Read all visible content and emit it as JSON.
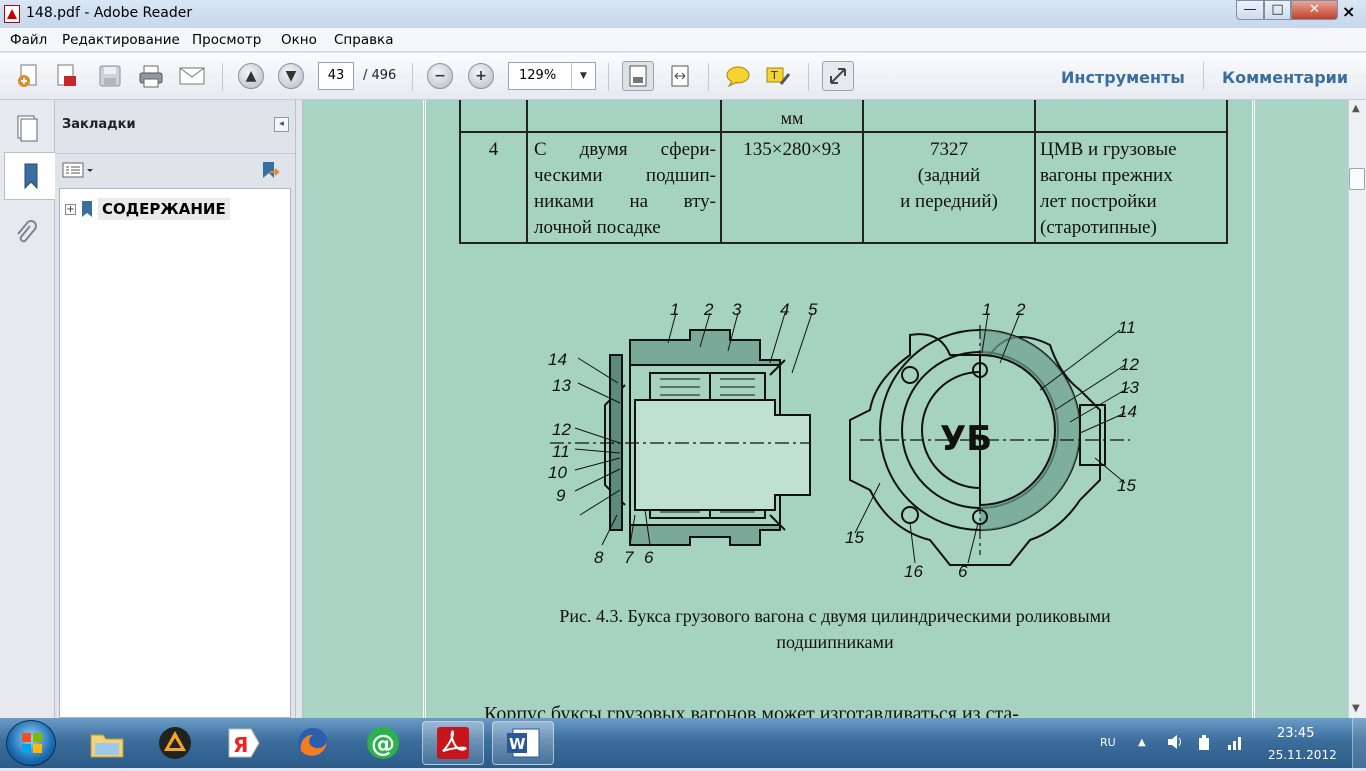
{
  "window": {
    "title": "148.pdf - Adobe Reader",
    "minimize": "—",
    "maximize": "□",
    "close": "✕"
  },
  "menu": {
    "items": [
      "Файл",
      "Редактирование",
      "Просмотр",
      "Окно",
      "Справка"
    ],
    "close_doc": "×"
  },
  "toolbar": {
    "page_current": "43",
    "page_total": "/ 496",
    "zoom": "129%",
    "tools_label": "Инструменты",
    "comments_label": "Комментарии"
  },
  "sidebar": {
    "panel_title": "Закладки",
    "bookmark": "СОДЕРЖАНИЕ"
  },
  "document": {
    "table_header": [
      "мм"
    ],
    "row": {
      "num": "4",
      "desc": [
        "С двумя сфери-",
        "ческими подшип-",
        "никами на вту-",
        "лочной посадке"
      ],
      "size": "135×280×93",
      "code": [
        "7327",
        "(задний",
        "и передний)"
      ],
      "usage": [
        "ЦМВ и грузовые",
        "вагоны прежних",
        "лет постройки",
        "(старотипные)"
      ]
    },
    "figure_labels_left": [
      "1",
      "2",
      "3",
      "4",
      "5",
      "14",
      "13",
      "12",
      "11",
      "10",
      "9",
      "8",
      "7",
      "6"
    ],
    "figure_labels_right": [
      "1",
      "2",
      "11",
      "12",
      "13",
      "14",
      "15",
      "15",
      "16",
      "6"
    ],
    "caption_line1": "Рис. 4.3. Букса грузового вагона с двумя цилиндрическими роликовыми",
    "caption_line2": "подшипниками",
    "body_text": "Корпус буксы грузовых вагонов может изготавливаться из ста-"
  },
  "taskbar": {
    "lang": "RU",
    "time": "23:45",
    "date": "25.11.2012"
  }
}
